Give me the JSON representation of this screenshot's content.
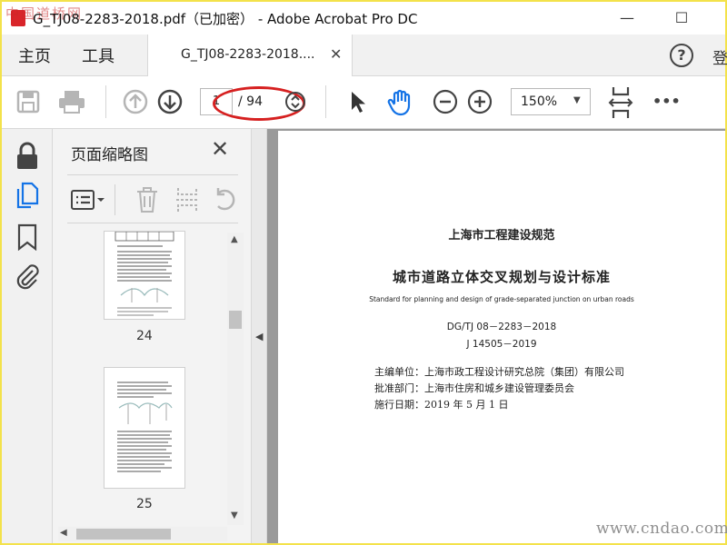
{
  "window": {
    "title": "G_TJ08-2283-2018.pdf（已加密） - Adobe Acrobat Pro DC",
    "watermark_top": "中国道桥网",
    "controls": {
      "minimize": "—",
      "maximize": "☐",
      "close": "✕"
    }
  },
  "tabs": {
    "home": "主页",
    "tools": "工具",
    "document": "G_TJ08-2283-2018....",
    "close": "✕",
    "help": "?",
    "signin": "登"
  },
  "toolbar": {
    "page_current": "1",
    "page_total": "/ 94",
    "zoom": "150%",
    "more": "•••"
  },
  "thumbnails": {
    "title": "页面缩略图",
    "close": "✕",
    "pages": [
      {
        "label": "24"
      },
      {
        "label": "25"
      }
    ]
  },
  "document": {
    "header": "上海市工程建设规范",
    "title_cn": "城市道路立体交叉规划与设计标准",
    "title_en": "Standard for planning and design of grade-separated junction on urban roads",
    "code1": "DG/TJ 08－2283－2018",
    "code2": "J 14505－2019",
    "editor": "主编单位：上海市政工程设计研究总院（集团）有限公司",
    "approver": "批准部门：上海市住房和城乡建设管理委员会",
    "date": "施行日期：2019 年 5 月 1 日"
  },
  "watermark_bottom": "www.cndao.com",
  "colors": {
    "accent_blue": "#1473e6",
    "annotation_red": "#d62020",
    "frame_yellow": "#f3e24b"
  }
}
